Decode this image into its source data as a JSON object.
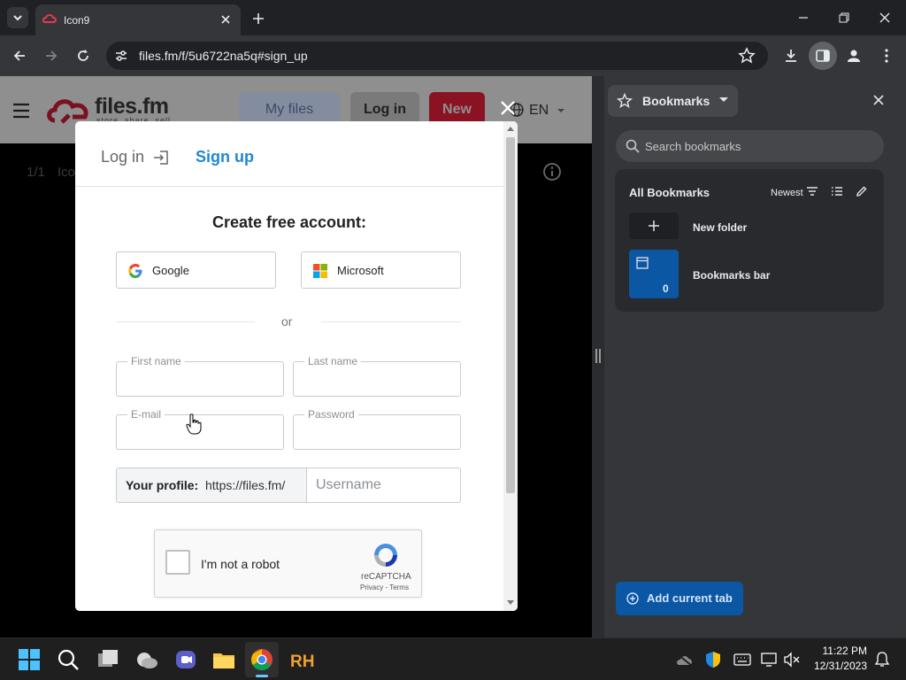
{
  "browser": {
    "tab": {
      "title": "Icon9"
    },
    "address": {
      "url": "files.fm/f/5u6722na5q#sign_up"
    }
  },
  "site": {
    "logo_text": "files.fm",
    "logo_tagline": "store, share, sell",
    "nav": {
      "my_files": "My files",
      "login": "Log in",
      "new": "New"
    },
    "language": "EN",
    "file_counter": "1/1",
    "file_name_partial": "Ico"
  },
  "modal": {
    "tabs": {
      "login": "Log in",
      "signup": "Sign up"
    },
    "heading": "Create free account:",
    "social": {
      "google": "Google",
      "microsoft": "Microsoft"
    },
    "divider": "or",
    "fields": {
      "first_name": "First name",
      "last_name": "Last name",
      "email": "E-mail",
      "password": "Password"
    },
    "profile": {
      "label": "Your profile:",
      "prefix": "https://files.fm/",
      "username_placeholder": "Username"
    },
    "captcha": {
      "label": "I'm not a robot",
      "brand": "reCAPTCHA",
      "links": "Privacy - Terms"
    }
  },
  "bookmarks": {
    "title": "Bookmarks",
    "search_placeholder": "Search bookmarks",
    "section_title": "All Bookmarks",
    "sort": "Newest",
    "new_folder": "New folder",
    "folders": [
      {
        "name": "Bookmarks bar",
        "count": "0"
      }
    ],
    "add_current": "Add current tab"
  },
  "taskbar": {
    "time": "11:22 PM",
    "date": "12/31/2023"
  },
  "colors": {
    "accent_blue": "#1a73e8",
    "signup_blue": "#1e88d6",
    "new_button": "#c8102e",
    "bookmark_folder": "#0b57a4"
  }
}
